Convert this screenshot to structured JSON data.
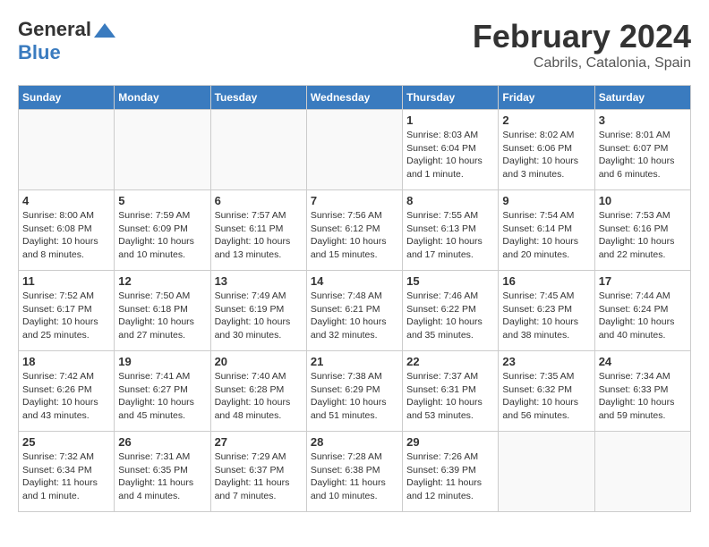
{
  "header": {
    "logo_general": "General",
    "logo_blue": "Blue",
    "title": "February 2024",
    "subtitle": "Cabrils, Catalonia, Spain"
  },
  "calendar": {
    "days_of_week": [
      "Sunday",
      "Monday",
      "Tuesday",
      "Wednesday",
      "Thursday",
      "Friday",
      "Saturday"
    ],
    "weeks": [
      [
        {
          "day": "",
          "info": ""
        },
        {
          "day": "",
          "info": ""
        },
        {
          "day": "",
          "info": ""
        },
        {
          "day": "",
          "info": ""
        },
        {
          "day": "1",
          "info": "Sunrise: 8:03 AM\nSunset: 6:04 PM\nDaylight: 10 hours and 1 minute."
        },
        {
          "day": "2",
          "info": "Sunrise: 8:02 AM\nSunset: 6:06 PM\nDaylight: 10 hours and 3 minutes."
        },
        {
          "day": "3",
          "info": "Sunrise: 8:01 AM\nSunset: 6:07 PM\nDaylight: 10 hours and 6 minutes."
        }
      ],
      [
        {
          "day": "4",
          "info": "Sunrise: 8:00 AM\nSunset: 6:08 PM\nDaylight: 10 hours and 8 minutes."
        },
        {
          "day": "5",
          "info": "Sunrise: 7:59 AM\nSunset: 6:09 PM\nDaylight: 10 hours and 10 minutes."
        },
        {
          "day": "6",
          "info": "Sunrise: 7:57 AM\nSunset: 6:11 PM\nDaylight: 10 hours and 13 minutes."
        },
        {
          "day": "7",
          "info": "Sunrise: 7:56 AM\nSunset: 6:12 PM\nDaylight: 10 hours and 15 minutes."
        },
        {
          "day": "8",
          "info": "Sunrise: 7:55 AM\nSunset: 6:13 PM\nDaylight: 10 hours and 17 minutes."
        },
        {
          "day": "9",
          "info": "Sunrise: 7:54 AM\nSunset: 6:14 PM\nDaylight: 10 hours and 20 minutes."
        },
        {
          "day": "10",
          "info": "Sunrise: 7:53 AM\nSunset: 6:16 PM\nDaylight: 10 hours and 22 minutes."
        }
      ],
      [
        {
          "day": "11",
          "info": "Sunrise: 7:52 AM\nSunset: 6:17 PM\nDaylight: 10 hours and 25 minutes."
        },
        {
          "day": "12",
          "info": "Sunrise: 7:50 AM\nSunset: 6:18 PM\nDaylight: 10 hours and 27 minutes."
        },
        {
          "day": "13",
          "info": "Sunrise: 7:49 AM\nSunset: 6:19 PM\nDaylight: 10 hours and 30 minutes."
        },
        {
          "day": "14",
          "info": "Sunrise: 7:48 AM\nSunset: 6:21 PM\nDaylight: 10 hours and 32 minutes."
        },
        {
          "day": "15",
          "info": "Sunrise: 7:46 AM\nSunset: 6:22 PM\nDaylight: 10 hours and 35 minutes."
        },
        {
          "day": "16",
          "info": "Sunrise: 7:45 AM\nSunset: 6:23 PM\nDaylight: 10 hours and 38 minutes."
        },
        {
          "day": "17",
          "info": "Sunrise: 7:44 AM\nSunset: 6:24 PM\nDaylight: 10 hours and 40 minutes."
        }
      ],
      [
        {
          "day": "18",
          "info": "Sunrise: 7:42 AM\nSunset: 6:26 PM\nDaylight: 10 hours and 43 minutes."
        },
        {
          "day": "19",
          "info": "Sunrise: 7:41 AM\nSunset: 6:27 PM\nDaylight: 10 hours and 45 minutes."
        },
        {
          "day": "20",
          "info": "Sunrise: 7:40 AM\nSunset: 6:28 PM\nDaylight: 10 hours and 48 minutes."
        },
        {
          "day": "21",
          "info": "Sunrise: 7:38 AM\nSunset: 6:29 PM\nDaylight: 10 hours and 51 minutes."
        },
        {
          "day": "22",
          "info": "Sunrise: 7:37 AM\nSunset: 6:31 PM\nDaylight: 10 hours and 53 minutes."
        },
        {
          "day": "23",
          "info": "Sunrise: 7:35 AM\nSunset: 6:32 PM\nDaylight: 10 hours and 56 minutes."
        },
        {
          "day": "24",
          "info": "Sunrise: 7:34 AM\nSunset: 6:33 PM\nDaylight: 10 hours and 59 minutes."
        }
      ],
      [
        {
          "day": "25",
          "info": "Sunrise: 7:32 AM\nSunset: 6:34 PM\nDaylight: 11 hours and 1 minute."
        },
        {
          "day": "26",
          "info": "Sunrise: 7:31 AM\nSunset: 6:35 PM\nDaylight: 11 hours and 4 minutes."
        },
        {
          "day": "27",
          "info": "Sunrise: 7:29 AM\nSunset: 6:37 PM\nDaylight: 11 hours and 7 minutes."
        },
        {
          "day": "28",
          "info": "Sunrise: 7:28 AM\nSunset: 6:38 PM\nDaylight: 11 hours and 10 minutes."
        },
        {
          "day": "29",
          "info": "Sunrise: 7:26 AM\nSunset: 6:39 PM\nDaylight: 11 hours and 12 minutes."
        },
        {
          "day": "",
          "info": ""
        },
        {
          "day": "",
          "info": ""
        }
      ]
    ]
  }
}
